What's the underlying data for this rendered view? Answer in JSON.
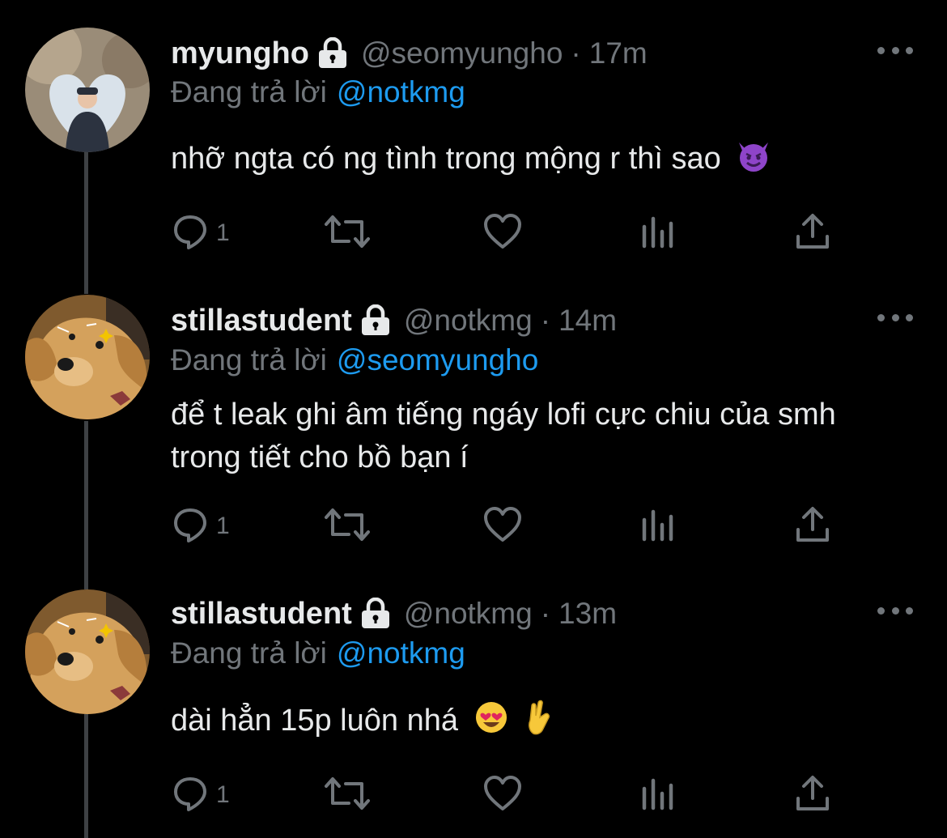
{
  "tweets": [
    {
      "name": "myungho",
      "handle": "@seomyungho",
      "separator": "·",
      "time": "17m",
      "replying_prefix": "Đang trả lời",
      "replying_to": "@notkmg",
      "text": "nhỡ ngta có ng tình trong mộng r thì sao",
      "emojis": [
        "smiling-imp"
      ],
      "reply_count": "1",
      "avatar": "person-heart-frame"
    },
    {
      "name": "stillastudent",
      "handle": "@notkmg",
      "separator": "·",
      "time": "14m",
      "replying_prefix": "Đang trả lời",
      "replying_to": "@seomyungho",
      "text": "để t leak ghi âm tiếng ngáy lofi cực chiu của smh trong tiết cho bồ bạn í",
      "emojis": [],
      "reply_count": "1",
      "avatar": "golden-puppy"
    },
    {
      "name": "stillastudent",
      "handle": "@notkmg",
      "separator": "·",
      "time": "13m",
      "replying_prefix": "Đang trả lời",
      "replying_to": "@notkmg",
      "text": "dài hẳn 15p luôn nhá",
      "emojis": [
        "heart-eyes",
        "crossed-fingers"
      ],
      "reply_count": "1",
      "avatar": "golden-puppy"
    }
  ],
  "icons": {
    "reply": "reply-icon",
    "retweet": "retweet-icon",
    "like": "heart-icon",
    "views": "views-icon",
    "share": "share-icon",
    "protected": "lock-icon",
    "more": "more-icon"
  },
  "colors": {
    "background": "#000000",
    "text": "#e7e9ea",
    "muted": "#71767b",
    "link": "#1d9bf0",
    "thread_line": "#3e4144"
  }
}
